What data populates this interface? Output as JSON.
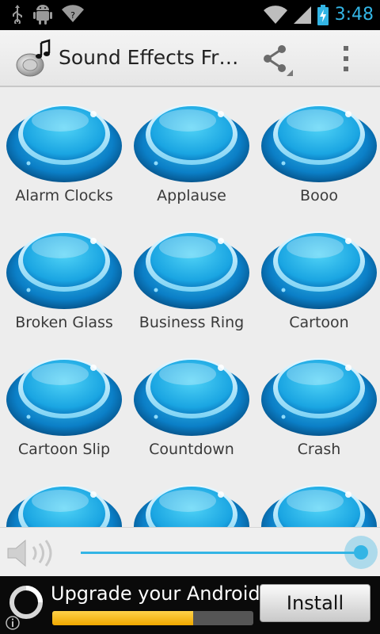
{
  "status_bar": {
    "time": "3:48",
    "icons": [
      "usb-icon",
      "android-debug-icon",
      "wifi-alert-icon",
      "wifi-icon",
      "signal-icon",
      "battery-charging-icon"
    ],
    "accent": "#33b5e5"
  },
  "action_bar": {
    "title": "Sound Effects Fr…",
    "icons": [
      "app-speaker-icon",
      "share-icon",
      "overflow-menu-icon"
    ]
  },
  "sounds": [
    {
      "label": "Alarm Clocks"
    },
    {
      "label": "Applause"
    },
    {
      "label": "Booo"
    },
    {
      "label": "Broken Glass"
    },
    {
      "label": "Business Ring"
    },
    {
      "label": "Cartoon"
    },
    {
      "label": "Cartoon Slip"
    },
    {
      "label": "Countdown"
    },
    {
      "label": "Crash"
    },
    {
      "label": ""
    },
    {
      "label": ""
    },
    {
      "label": ""
    }
  ],
  "volume": {
    "icon": "speaker-icon",
    "level": 1.0
  },
  "ad": {
    "headline": "Upgrade your Android!",
    "button_label": "Install",
    "progress": 0.7,
    "icons": [
      "loading-ring-icon",
      "info-icon"
    ]
  }
}
